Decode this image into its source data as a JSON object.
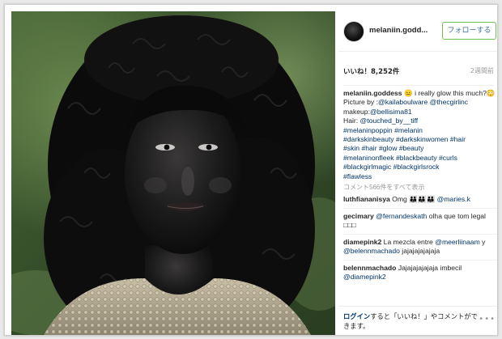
{
  "post": {
    "image_alt": "portrait photo",
    "username": "melaniin.goddess",
    "username_header": "melaniin.godd...",
    "follow_label": "フォローする",
    "likes": "いいね！8,252件",
    "time_ago": "2週間前",
    "caption": {
      "user": "melaniin.goddess",
      "segments": [
        {
          "t": " 😐 i really glow this much?😳",
          "tag": false
        },
        {
          "t": "\nPicture by :",
          "tag": false
        },
        {
          "t": "@kailaboulware",
          "tag": true
        },
        {
          "t": " ",
          "tag": false
        },
        {
          "t": "@thecgirlinc",
          "tag": true
        },
        {
          "t": "\nmakeup:",
          "tag": false
        },
        {
          "t": "@bellisima81",
          "tag": true
        },
        {
          "t": "\nHair: ",
          "tag": false
        },
        {
          "t": "@touched_by__tiff",
          "tag": true
        },
        {
          "t": "\n",
          "tag": false
        },
        {
          "t": "#melaninpoppin",
          "tag": true
        },
        {
          "t": " ",
          "tag": false
        },
        {
          "t": "#melanin",
          "tag": true
        },
        {
          "t": "\n",
          "tag": false
        },
        {
          "t": "#darkskinbeauty",
          "tag": true
        },
        {
          "t": " ",
          "tag": false
        },
        {
          "t": "#darkskinwomen",
          "tag": true
        },
        {
          "t": " ",
          "tag": false
        },
        {
          "t": "#hair",
          "tag": true
        },
        {
          "t": "\n",
          "tag": false
        },
        {
          "t": "#skin",
          "tag": true
        },
        {
          "t": " ",
          "tag": false
        },
        {
          "t": "#hair",
          "tag": true
        },
        {
          "t": " ",
          "tag": false
        },
        {
          "t": "#glow",
          "tag": true
        },
        {
          "t": " ",
          "tag": false
        },
        {
          "t": "#beauty",
          "tag": true
        },
        {
          "t": "\n",
          "tag": false
        },
        {
          "t": "#melaninonfleek",
          "tag": true
        },
        {
          "t": " ",
          "tag": false
        },
        {
          "t": "#blackbeauty",
          "tag": true
        },
        {
          "t": " ",
          "tag": false
        },
        {
          "t": "#curls",
          "tag": true
        },
        {
          "t": "\n",
          "tag": false
        },
        {
          "t": "#blackgirlmagic",
          "tag": true
        },
        {
          "t": " ",
          "tag": false
        },
        {
          "t": "#blackgirlsrock",
          "tag": true
        },
        {
          "t": "\n",
          "tag": false
        },
        {
          "t": "#flawless",
          "tag": true
        }
      ]
    },
    "more_comments": "コメント566件をすべて表示",
    "comments": [
      {
        "user": "luthfiananisya",
        "segments": [
          {
            "t": " Omg 👪👪👪 ",
            "tag": false
          },
          {
            "t": "@maries.k",
            "tag": true
          }
        ]
      },
      {
        "user": "gecimary",
        "segments": [
          {
            "t": " ",
            "tag": false
          },
          {
            "t": "@fernandeskath",
            "tag": true
          },
          {
            "t": " olha que tom legal □□□",
            "tag": false
          }
        ]
      },
      {
        "user": "diamepink2",
        "segments": [
          {
            "t": " La mezcla entre ",
            "tag": false
          },
          {
            "t": "@meerliinaam",
            "tag": true
          },
          {
            "t": " y ",
            "tag": false
          },
          {
            "t": "@belennmachado",
            "tag": true
          },
          {
            "t": " jajajajajajaja",
            "tag": false
          }
        ]
      },
      {
        "user": "belennmachado",
        "segments": [
          {
            "t": " Jajajajajajaja imbecil ",
            "tag": false
          },
          {
            "t": "@diamepink2",
            "tag": true
          }
        ]
      }
    ],
    "footer": {
      "login_label": "ログイン",
      "login_suffix": "すると「いいね！」やコメントができます。",
      "more_label": "•••"
    }
  },
  "colors": {
    "link": "#003569",
    "follow_border": "#70c050",
    "follow_text": "#3f729b",
    "muted": "#999999"
  }
}
